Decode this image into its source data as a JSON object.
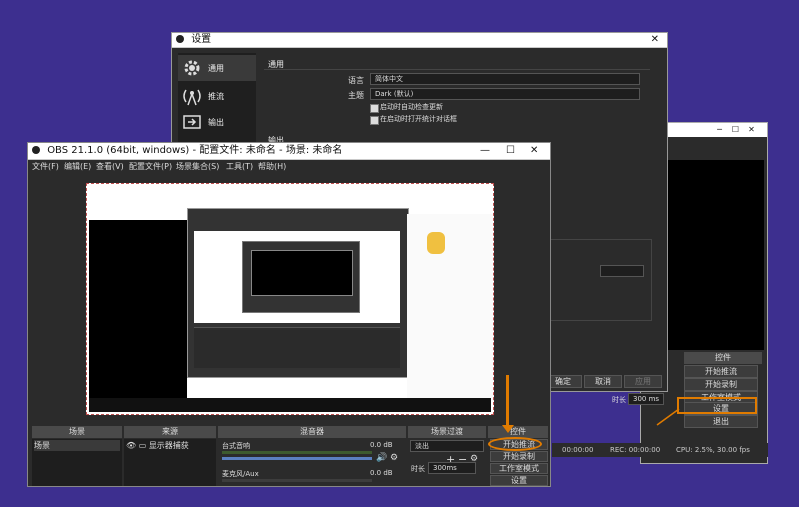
{
  "colors": {
    "bg": "#3d2f8f",
    "highlight": "#e07b00",
    "obs_dark": "#2b2b2b"
  },
  "back_window": {
    "controls_header": "控件",
    "buttons": [
      "开始推流",
      "开始录制",
      "工作室模式",
      "设置",
      "退出"
    ],
    "status": {
      "time_a": "00:00:00",
      "rec": "REC: 00:00:00",
      "cpu": "CPU: 2.5%, 30.00 fps"
    },
    "duration_label": "时长",
    "duration_value": "300 ms",
    "title_controls": [
      "─",
      "☐",
      "✕"
    ]
  },
  "settings": {
    "title": "设置",
    "close": "✕",
    "sidebar": [
      {
        "label": "通用",
        "icon": "gear-icon"
      },
      {
        "label": "推流",
        "icon": "broadcast-icon"
      },
      {
        "label": "输出",
        "icon": "output-icon"
      }
    ],
    "section_general": "通用",
    "language_label": "语言",
    "language_value": "简体中文",
    "theme_label": "主题",
    "theme_value": "Dark (默认)",
    "checkbox_update": "启动时自动检查更新",
    "checkbox_stats": "在启动时打开统计对话框",
    "section_output": "输出",
    "buttons": [
      "确定",
      "取消",
      "应用"
    ]
  },
  "obs": {
    "title": "OBS 21.1.0 (64bit, windows) - 配置文件: 未命名 - 场景: 未命名",
    "title_controls": [
      "—",
      "☐",
      "✕"
    ],
    "menu": [
      "文件(F)",
      "编辑(E)",
      "查看(V)",
      "配置文件(P)",
      "场景集合(S)",
      "工具(T)",
      "帮助(H)"
    ],
    "panels": [
      "场景",
      "来源",
      "混音器",
      "场景过渡",
      "控件"
    ],
    "scene_item": "场景",
    "source_item": "显示器捕获",
    "mixer": [
      {
        "name": "台式音响",
        "db": "0.0 dB",
        "level": 0.95
      },
      {
        "name": "麦克风/Aux",
        "db": "0.0 dB",
        "level": 0.0
      }
    ],
    "transition_value": "淡出",
    "duration_label": "时长",
    "duration_value": "300ms",
    "controls": [
      "开始推流",
      "开始录制",
      "工作室模式",
      "设置"
    ]
  }
}
